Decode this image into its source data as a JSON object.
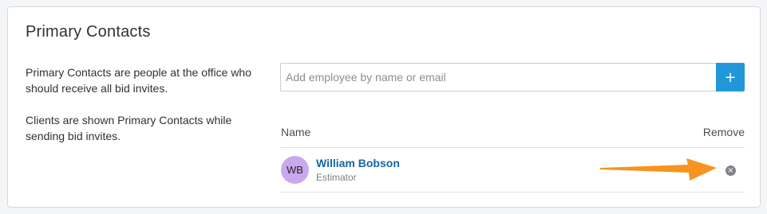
{
  "section": {
    "title": "Primary Contacts",
    "description_1": "Primary Contacts are people at the office who should receive all bid invites.",
    "description_2": "Clients are shown Primary Contacts while sending bid invites."
  },
  "search": {
    "placeholder": "Add employee by name or email",
    "value": "",
    "add_label": "+"
  },
  "table": {
    "columns": {
      "name": "Name",
      "remove": "Remove"
    },
    "rows": [
      {
        "initials": "WB",
        "name": "William Bobson",
        "role": "Estimator",
        "remove_icon": "×"
      }
    ]
  },
  "colors": {
    "accent": "#2196d9",
    "link": "#1565a8",
    "avatar": "#c9a8ee",
    "annotation_arrow": "#f7931e"
  },
  "icons": {
    "add": "plus-icon",
    "remove": "remove-circle-icon",
    "annotation": "arrow-annotation-icon"
  }
}
